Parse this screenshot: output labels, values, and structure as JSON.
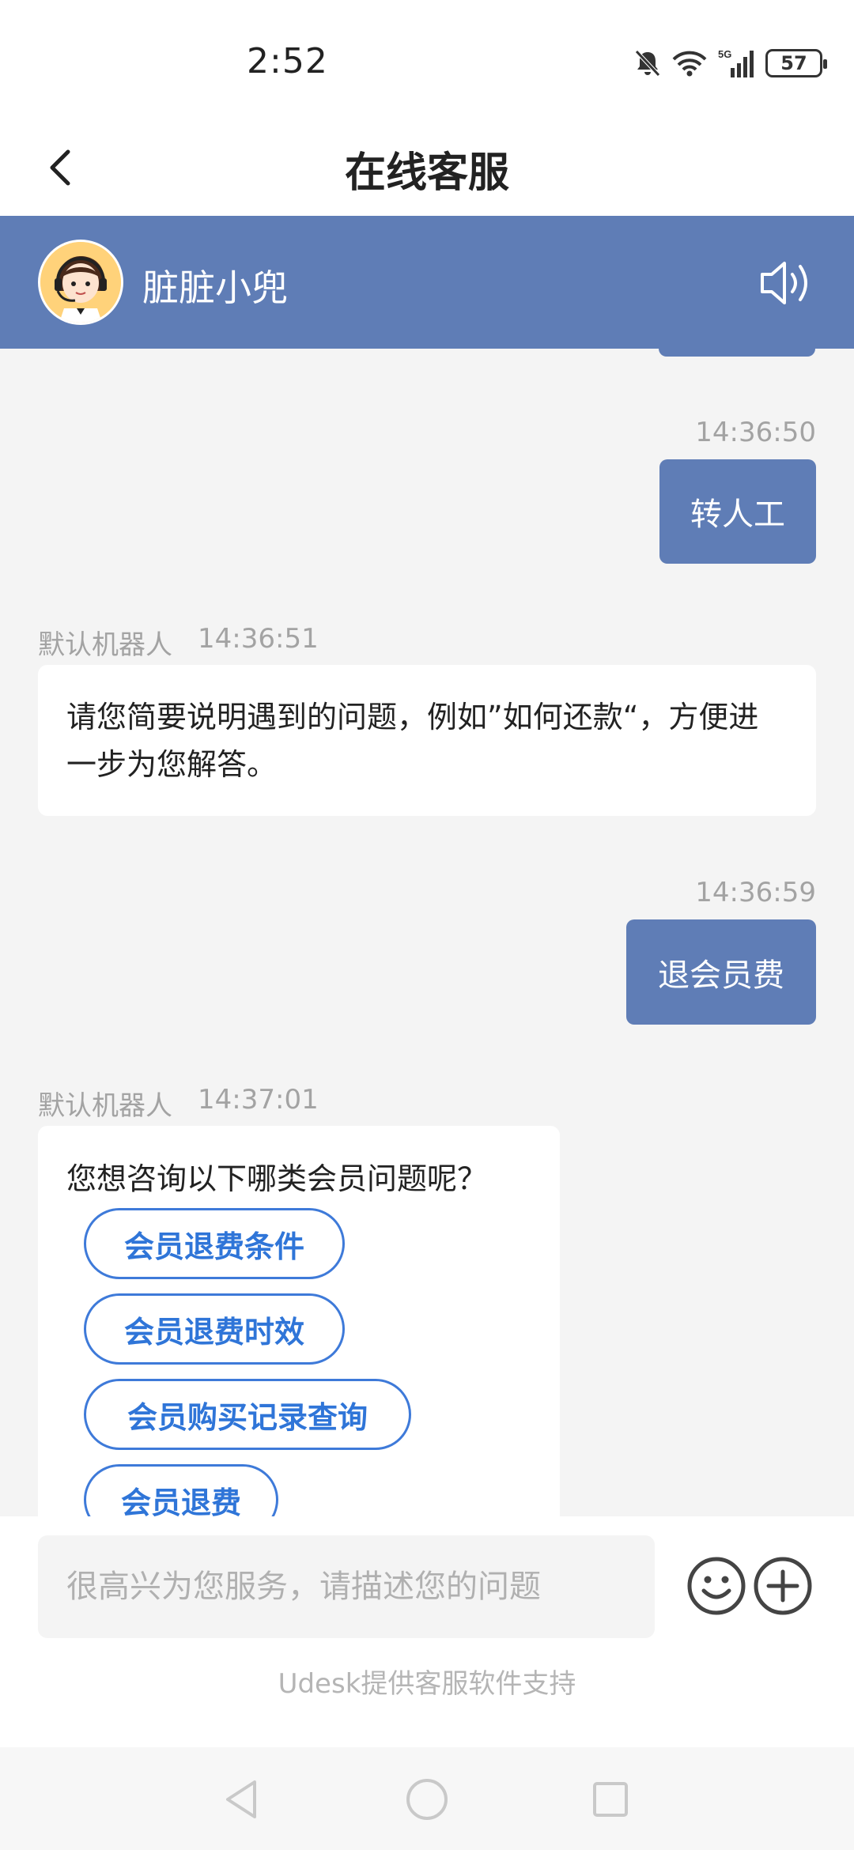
{
  "status_bar": {
    "time": "2:52",
    "battery": "57"
  },
  "nav": {
    "title": "在线客服"
  },
  "agent": {
    "name": "脏脏小兜"
  },
  "messages": [
    {
      "from": "user",
      "time": "14:36:50",
      "text": "转人工"
    },
    {
      "from": "bot",
      "sender": "默认机器人",
      "time": "14:36:51",
      "text": "请您简要说明遇到的问题，例如”如何还款“，方便进一步为您解答。"
    },
    {
      "from": "user",
      "time": "14:36:59",
      "text": "退会员费"
    },
    {
      "from": "bot",
      "sender": "默认机器人",
      "time": "14:37:01",
      "text": "您想咨询以下哪类会员问题呢？",
      "options": [
        "会员退费条件",
        "会员退费时效",
        "会员购买记录查询",
        "会员退费"
      ]
    }
  ],
  "input": {
    "placeholder": "很高兴为您服务，请描述您的问题"
  },
  "footer": {
    "powered_by": "Udesk提供客服软件支持"
  },
  "icons": [
    "back-icon",
    "speaker-icon",
    "emoji-icon",
    "plus-icon",
    "mute-bell-icon",
    "wifi-icon",
    "signal-icon",
    "battery-icon"
  ],
  "colors": {
    "header_bg": "#5f7db6",
    "user_bubble": "#5f7db6",
    "option_blue": "#2f75d8",
    "chat_bg": "#f4f4f4"
  }
}
